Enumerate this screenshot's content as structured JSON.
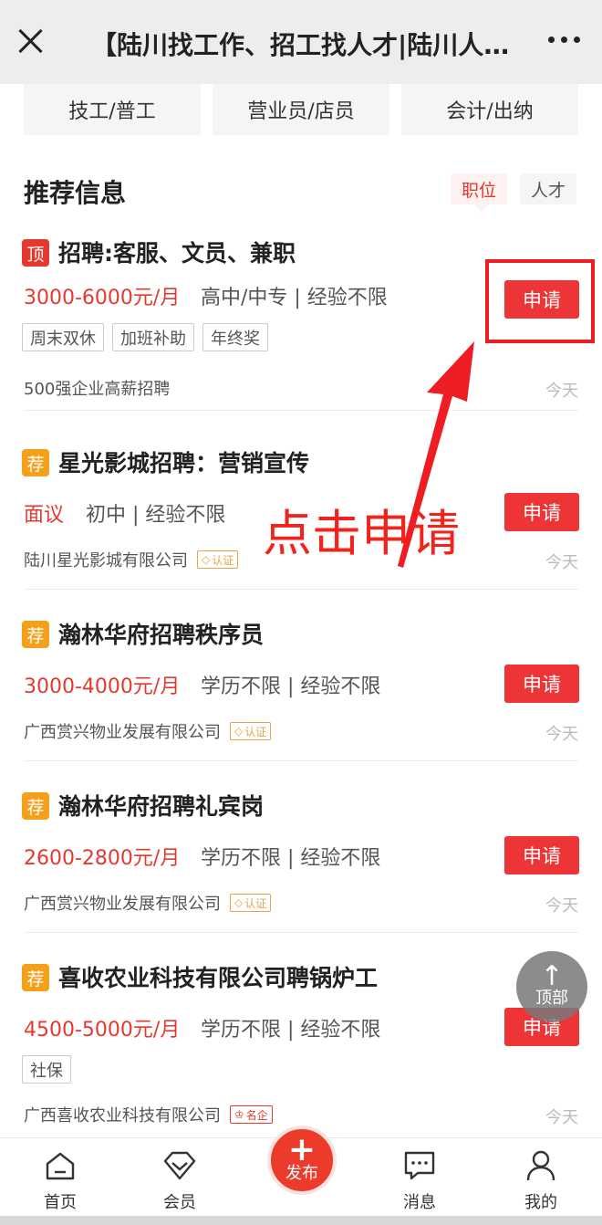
{
  "header": {
    "title": "【陆川找工作、招工找人才|陆川人才网】"
  },
  "categories": [
    "技工/普工",
    "营业员/店员",
    "会计/出纳"
  ],
  "section": {
    "title": "推荐信息",
    "toggle_active": "职位",
    "toggle_inactive": "人才"
  },
  "jobs": [
    {
      "badge": "顶",
      "title": "招聘:客服、文员、兼职",
      "salary": "3000-6000元/月",
      "requirements": "高中/中专 | 经验不限",
      "tags": [
        "周末双休",
        "加班补助",
        "年终奖"
      ],
      "company": "500强企业高薪招聘",
      "cert": "",
      "time": "今天",
      "apply_label": "申请"
    },
    {
      "badge": "荐",
      "title": "星光影城招聘：营销宣传",
      "salary": "面议",
      "requirements": "初中 | 经验不限",
      "tags": [],
      "company": "陆川星光影城有限公司",
      "cert": "认证",
      "time": "今天",
      "apply_label": "申请"
    },
    {
      "badge": "荐",
      "title": "瀚林华府招聘秩序员",
      "salary": "3000-4000元/月",
      "requirements": "学历不限 | 经验不限",
      "tags": [],
      "company": "广西赏兴物业发展有限公司",
      "cert": "认证",
      "time": "今天",
      "apply_label": "申请"
    },
    {
      "badge": "荐",
      "title": "瀚林华府招聘礼宾岗",
      "salary": "2600-2800元/月",
      "requirements": "学历不限 | 经验不限",
      "tags": [],
      "company": "广西赏兴物业发展有限公司",
      "cert": "认证",
      "time": "今天",
      "apply_label": "申请"
    },
    {
      "badge": "荐",
      "title": "喜收农业科技有限公司聘锅炉工",
      "salary": "4500-5000元/月",
      "requirements": "学历不限 | 经验不限",
      "tags": [
        "社保"
      ],
      "company": "广西喜收农业科技有限公司",
      "cert": "名企",
      "time": "今天",
      "apply_label": "申请"
    }
  ],
  "annotation": {
    "text": "点击申请",
    "color": "#f2231b"
  },
  "back_to_top": {
    "icon": "arrow-up-icon",
    "label": "顶部"
  },
  "nav": {
    "home": "首页",
    "member": "会员",
    "publish": "发布",
    "messages": "消息",
    "mine": "我的"
  },
  "colors": {
    "accent": "#ed3436",
    "top_badge": "#e5392f",
    "recommend_badge": "#f4a01b"
  }
}
